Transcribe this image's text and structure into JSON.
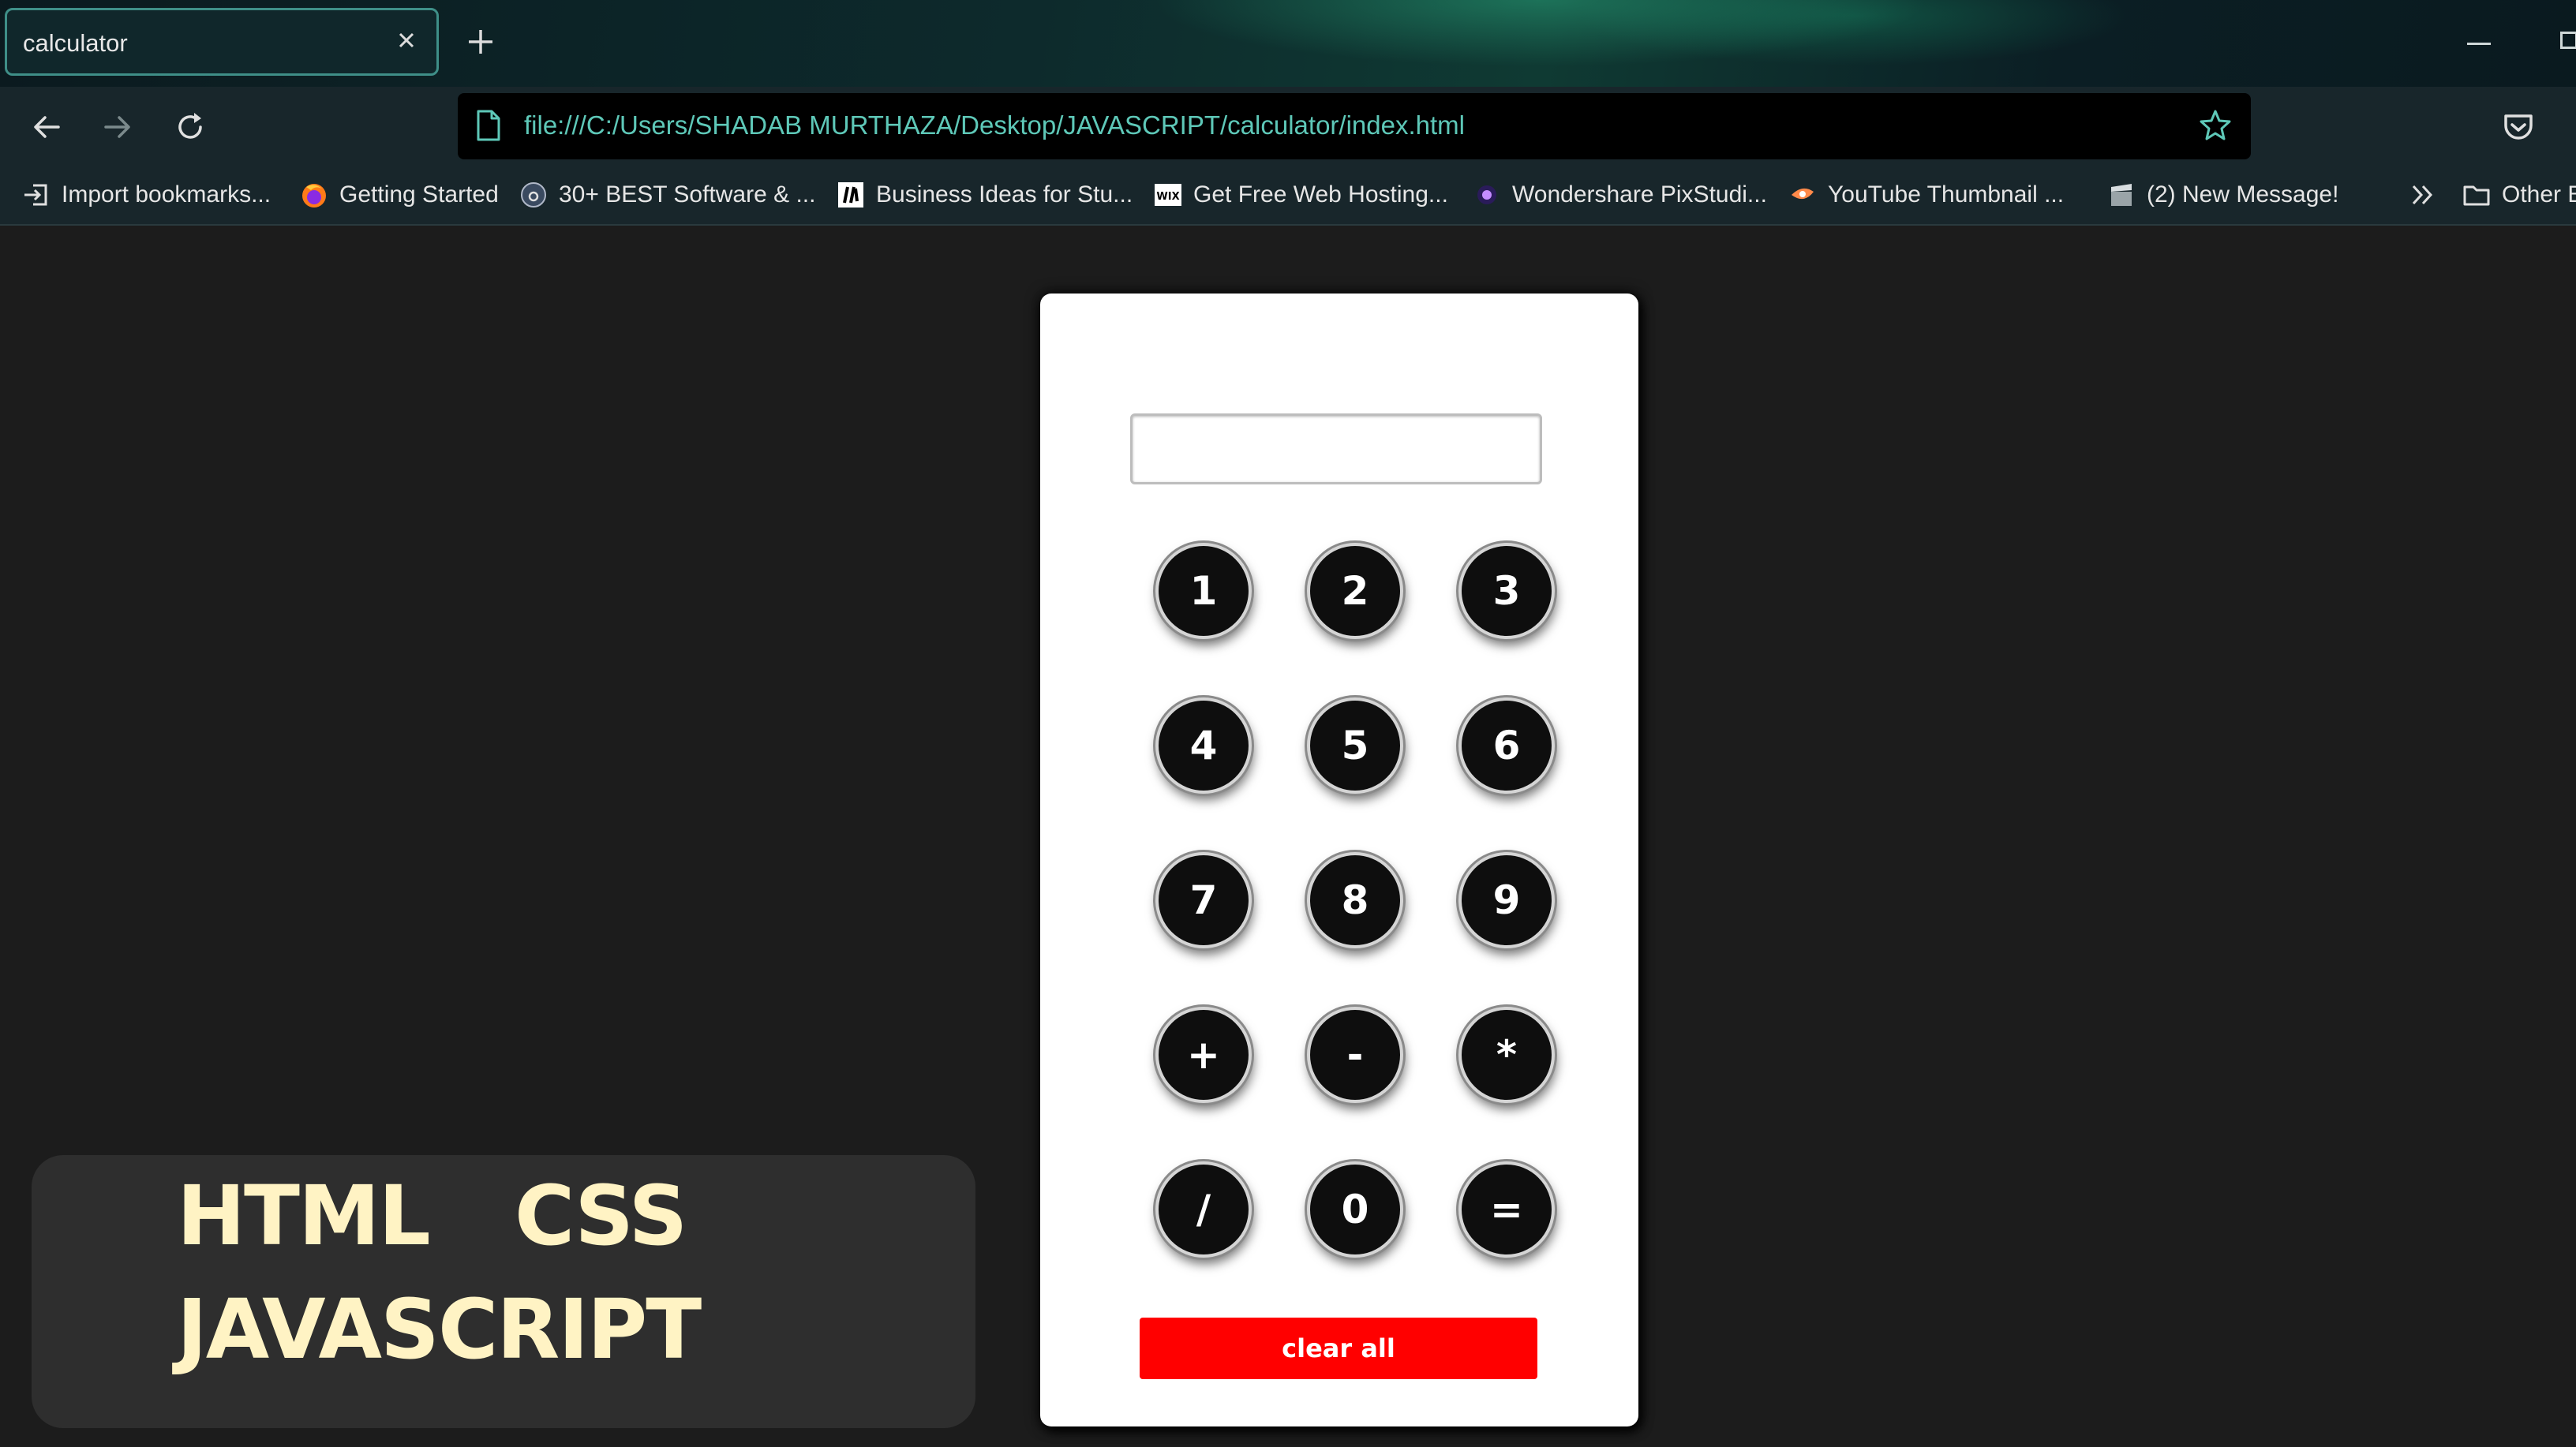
{
  "browser": {
    "tab_title": "calculator",
    "url": "file:///C:/Users/SHADAB MURTHAZA/Desktop/JAVASCRIPT/calculator/index.html",
    "bookmarks": [
      {
        "label": "Import bookmarks...",
        "icon": "import-icon"
      },
      {
        "label": "Getting Started",
        "icon": "firefox-icon"
      },
      {
        "label": "30+ BEST Software & ...",
        "icon": "circle-logo-icon"
      },
      {
        "label": "Business Ideas for Stu...",
        "icon": "site-logo-icon"
      },
      {
        "label": "Get Free Web Hosting...",
        "icon": "wix-icon"
      },
      {
        "label": "Wondershare PixStudi...",
        "icon": "pixstudio-icon"
      },
      {
        "label": "YouTube Thumbnail ...",
        "icon": "thumbnail-icon"
      },
      {
        "label": "(2) New Message!",
        "icon": "clapper-icon"
      }
    ],
    "other_bookmarks_label": "Other B"
  },
  "calculator": {
    "display_value": "",
    "keys": [
      "1",
      "2",
      "3",
      "4",
      "5",
      "6",
      "7",
      "8",
      "9",
      "+",
      "-",
      "*",
      "/",
      "0",
      "="
    ],
    "clear_label": "clear all",
    "clear_color": "#ff0000"
  },
  "badge": {
    "words": [
      "HTML",
      "CSS",
      "JAVASCRIPT"
    ],
    "text_color": "#fff3c4"
  }
}
